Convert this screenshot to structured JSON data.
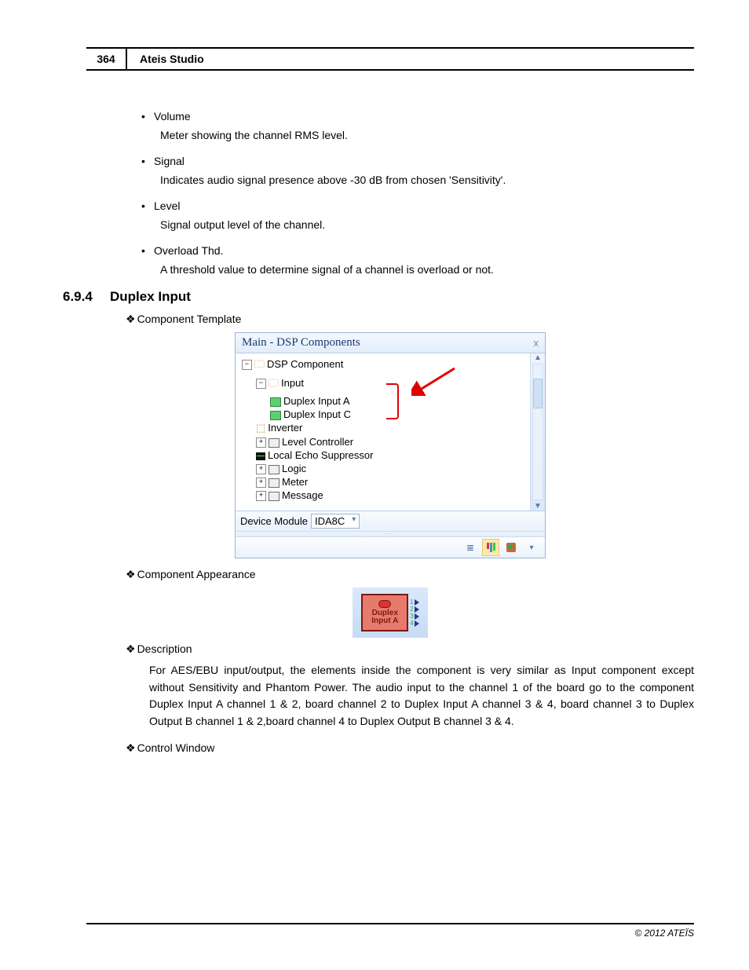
{
  "header": {
    "page_num": "364",
    "title": "Ateis Studio"
  },
  "bullets": [
    {
      "label": "Volume",
      "desc": "Meter showing the channel RMS level."
    },
    {
      "label": "Signal",
      "desc": "Indicates audio signal presence above -30 dB from chosen 'Sensitivity'."
    },
    {
      "label": "Level",
      "desc": "Signal output level of the channel."
    },
    {
      "label": "Overload Thd.",
      "desc": "A threshold value to determine signal of a channel is overload or not."
    }
  ],
  "section": {
    "num": "6.9.4",
    "title": "Duplex Input"
  },
  "subheadings": {
    "template": "Component Template",
    "appearance": "Component Appearance",
    "description": "Description",
    "control": "Control Window"
  },
  "tree": {
    "title": "Main - DSP Components",
    "close": "x",
    "root": "DSP Component",
    "input": "Input",
    "duplex_a": "Duplex Input A",
    "duplex_c": "Duplex Input C",
    "inverter": "Inverter",
    "level": "Level Controller",
    "echo": "Local Echo Suppressor",
    "logic": "Logic",
    "meter": "Meter",
    "message": "Message",
    "device_label": "Device Module",
    "device_value": "IDA8C"
  },
  "component_block": {
    "line1": "Duplex",
    "line2": "Input A",
    "ports": [
      "1",
      "2",
      "3",
      "4"
    ]
  },
  "description_text": "For AES/EBU input/output, the elements inside the component is very similar as Input component except without Sensitivity and Phantom Power. The audio input to the channel 1 of the board go to the component Duplex Input A channel 1 & 2, board channel 2 to Duplex Input A channel 3 & 4, board channel 3 to Duplex Output B channel 1 & 2,board channel 4 to Duplex Output B channel 3 & 4.",
  "footer": "© 2012 ATEÏS"
}
